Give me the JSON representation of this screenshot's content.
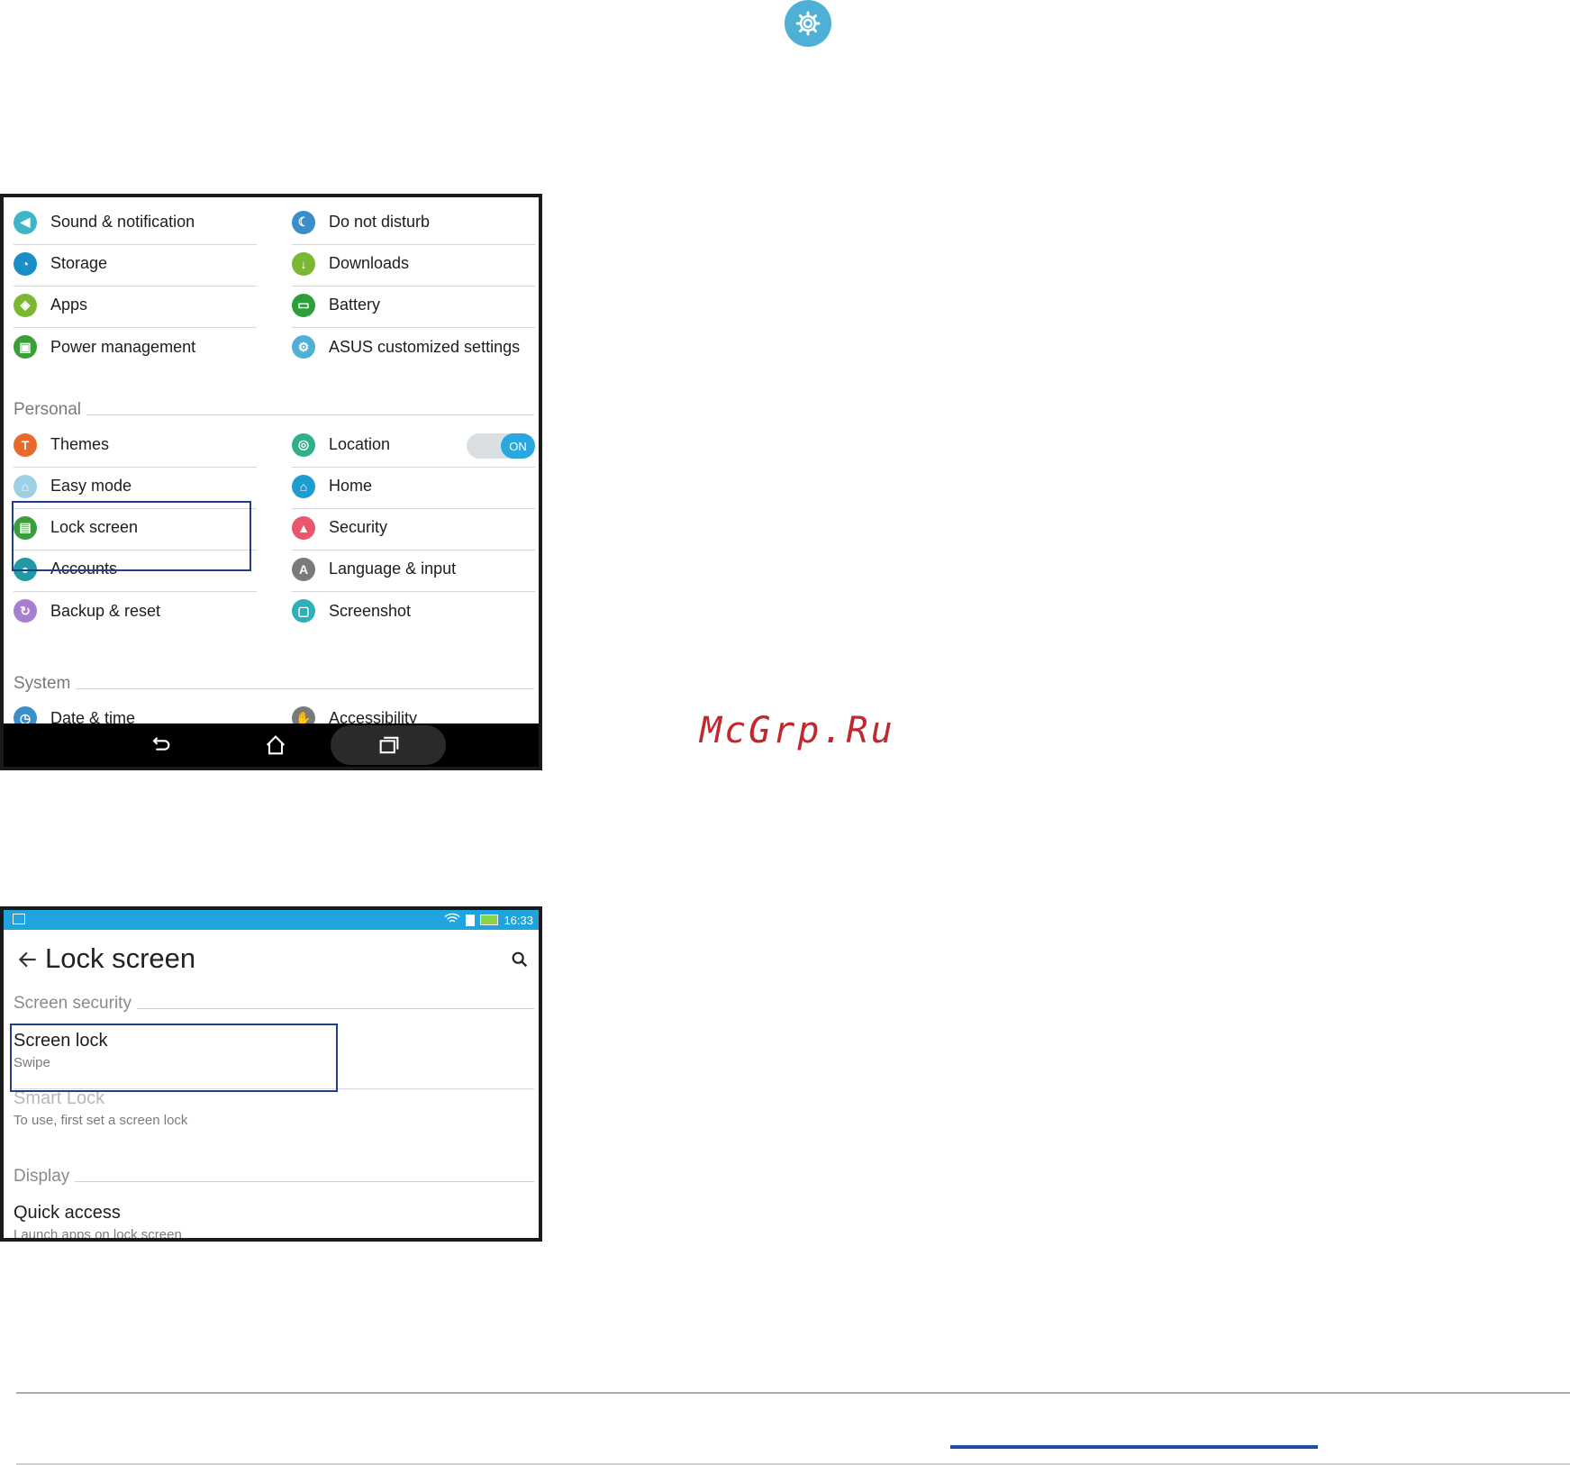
{
  "colors": {
    "accent": "#1fa4de",
    "highlight_box": "#1f3f87",
    "watermark": "#c0282d"
  },
  "settings": {
    "rows_left": [
      {
        "label": "Sound & notification",
        "icon": "speaker-icon",
        "color": "#3fb5c8",
        "glyph": "◀"
      },
      {
        "label": "Storage",
        "icon": "storage-icon",
        "color": "#1a8fc7",
        "glyph": "◔"
      },
      {
        "label": "Apps",
        "icon": "apps-icon",
        "color": "#7bb832",
        "glyph": "◈"
      },
      {
        "label": "Power management",
        "icon": "power-icon",
        "color": "#3a9e3a",
        "glyph": "▣"
      }
    ],
    "rows_right": [
      {
        "label": "Do not disturb",
        "icon": "moon-icon",
        "color": "#3a8ec9",
        "glyph": "☾"
      },
      {
        "label": "Downloads",
        "icon": "download-icon",
        "color": "#7bb832",
        "glyph": "↓"
      },
      {
        "label": "Battery",
        "icon": "battery-icon",
        "color": "#2c9e3a",
        "glyph": "▭"
      },
      {
        "label": "ASUS customized settings",
        "icon": "asus-settings-icon",
        "color": "#4fb0d6",
        "glyph": "⚙"
      }
    ],
    "personal_label": "Personal",
    "personal_left": [
      {
        "label": "Themes",
        "icon": "themes-icon",
        "color": "#e8692a",
        "glyph": "T"
      },
      {
        "label": "Easy mode",
        "icon": "easy-mode-icon",
        "color": "#9fcfe4",
        "glyph": "⌂"
      },
      {
        "label": "Lock screen",
        "icon": "lock-screen-icon",
        "color": "#3a9e3a",
        "glyph": "▤"
      },
      {
        "label": "Accounts",
        "icon": "accounts-icon",
        "color": "#1f9aa6",
        "glyph": "●"
      },
      {
        "label": "Backup & reset",
        "icon": "backup-icon",
        "color": "#a77fcf",
        "glyph": "↻"
      }
    ],
    "personal_right": [
      {
        "label": "Location",
        "icon": "location-icon",
        "color": "#2fb08b",
        "glyph": "◎"
      },
      {
        "label": "Home",
        "icon": "home-icon",
        "color": "#1f9ccf",
        "glyph": "⌂"
      },
      {
        "label": "Security",
        "icon": "lock-icon",
        "color": "#e8586a",
        "glyph": "▲"
      },
      {
        "label": "Language & input",
        "icon": "language-icon",
        "color": "#7a7a7a",
        "glyph": "A"
      },
      {
        "label": "Screenshot",
        "icon": "screenshot-icon",
        "color": "#2fb0b8",
        "glyph": "▢"
      }
    ],
    "location_toggle": "ON",
    "system_label": "System",
    "system_left": [
      {
        "label": "Date & time",
        "icon": "clock-icon",
        "color": "#3a8ec9",
        "glyph": "◷"
      }
    ],
    "system_right": [
      {
        "label": "Accessibility",
        "icon": "accessibility-icon",
        "color": "#7a7a7a",
        "glyph": "✋"
      }
    ]
  },
  "lockscreen": {
    "status_time": "16:33",
    "title": "Lock screen",
    "section_security": "Screen security",
    "screen_lock_title": "Screen lock",
    "screen_lock_sub": "Swipe",
    "smart_lock_title": "Smart Lock",
    "smart_lock_sub": "To use, first set a screen lock",
    "section_display": "Display",
    "quick_access_title": "Quick access",
    "quick_access_sub": "Launch apps on lock screen"
  },
  "watermark": "McGrp.Ru"
}
